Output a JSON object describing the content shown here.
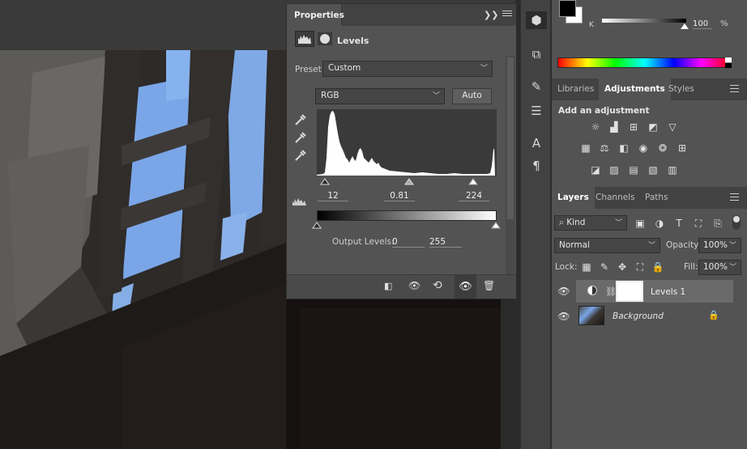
{
  "properties": {
    "tab_label": "Properties",
    "panel_title": "Levels",
    "preset_label": "Preset:",
    "preset_value": "Custom",
    "channel_value": "RGB",
    "auto_label": "Auto",
    "input_black": "12",
    "input_gamma": "0.81",
    "input_white": "224",
    "output_label": "Output Levels:",
    "output_black": "0",
    "output_white": "255"
  },
  "color": {
    "channel_label": "K",
    "value": "100",
    "unit": "%"
  },
  "adjustments": {
    "tabs": [
      "Libraries",
      "Adjustments",
      "Styles"
    ],
    "hint": "Add an adjustment"
  },
  "layers": {
    "tabs": [
      "Layers",
      "Channels",
      "Paths"
    ],
    "filter_label": "Kind",
    "blend_mode": "Normal",
    "opacity_label": "Opacity:",
    "opacity_value": "100%",
    "lock_label": "Lock:",
    "fill_label": "Fill:",
    "fill_value": "100%",
    "items": [
      {
        "name": "Levels 1"
      },
      {
        "name": "Background"
      }
    ]
  },
  "colors": {
    "panel_bg": "#535353",
    "dark_bg": "#424242",
    "selected_layer": "#6a6a6a",
    "sky": "#7aa6e8"
  }
}
